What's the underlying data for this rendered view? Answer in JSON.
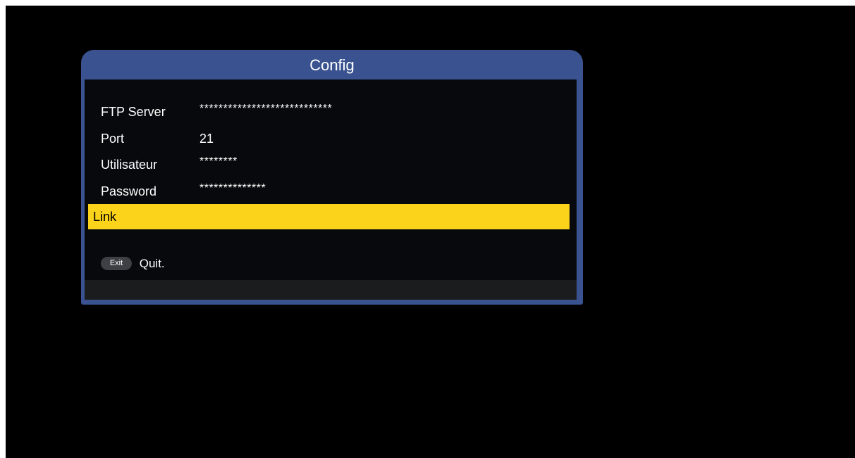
{
  "dialog": {
    "title": "Config",
    "fields": [
      {
        "label": "FTP Server",
        "value": "****************************"
      },
      {
        "label": "Port",
        "value": "21"
      },
      {
        "label": "Utilisateur",
        "value": "********"
      },
      {
        "label": "Password",
        "value": "**************"
      },
      {
        "label": "Link",
        "value": ""
      }
    ],
    "selected_index": 4
  },
  "help": {
    "key_label": "Exit",
    "action_label": "Quit."
  },
  "colors": {
    "frame": "#3a5390",
    "highlight": "#fad31a",
    "body": "#07090c"
  }
}
